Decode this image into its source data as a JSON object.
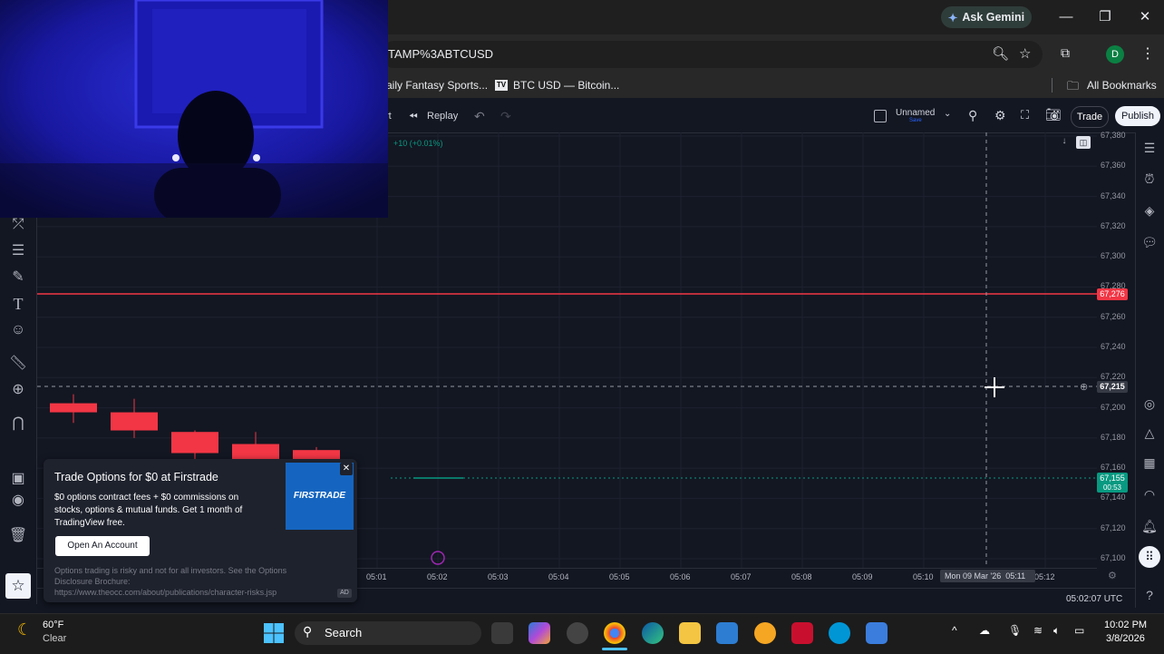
{
  "browser": {
    "url": "TAMP%3ABTCUSD",
    "ask_gemini": "Ask Gemini",
    "profile_initial": "D",
    "bookmarks": [
      "aily Fantasy Sports...",
      "BTC USD — Bitcoin..."
    ],
    "bookmark_icon_text": "TV",
    "all_bookmarks": "All Bookmarks"
  },
  "tv_toolbar": {
    "alert_partial": "rt",
    "replay": "Replay",
    "layout_name": "Unnamed",
    "layout_sub": "Save",
    "trade": "Trade",
    "publish": "Publish"
  },
  "symbol_change": "+10 (+0.01%)",
  "y_axis_ticks": [
    "67,380",
    "67,360",
    "67,340",
    "67,320",
    "67,300",
    "67,280",
    "67,260",
    "67,240",
    "67,220",
    "67,200",
    "67,180",
    "67,160",
    "67,140",
    "67,120",
    "67,100"
  ],
  "x_axis_ticks": [
    "05:01",
    "05:02",
    "05:03",
    "05:04",
    "05:05",
    "05:06",
    "05:07",
    "05:08",
    "05:09",
    "05:10",
    "05:12"
  ],
  "crosshair": {
    "price": "67,215",
    "date": "Mon 09 Mar '26",
    "time": "05:11"
  },
  "alert_line": {
    "price": "67,276",
    "color": "#f23645"
  },
  "last_price": {
    "price": "67,155",
    "countdown": "00:53",
    "color": "#089981"
  },
  "clock": "05:02:07 UTC",
  "chart_data": {
    "type": "candlestick",
    "ylim": [
      67100,
      67380
    ],
    "alert_level": 67276,
    "last_price": 67155,
    "crosshair_price": 67215,
    "candles": [
      {
        "x": "04:55",
        "open": 67221,
        "close": 67198,
        "high": 67221,
        "low": 67188
      },
      {
        "x": "04:56",
        "open": 67203,
        "close": 67197,
        "high": 67209,
        "low": 67190
      },
      {
        "x": "04:57",
        "open": 67197,
        "close": 67185,
        "high": 67206,
        "low": 67180
      },
      {
        "x": "04:58",
        "open": 67184,
        "close": 67170,
        "high": 67185,
        "low": 67162
      },
      {
        "x": "04:59",
        "open": 67176,
        "close": 67166,
        "high": 67184,
        "low": 67160
      },
      {
        "x": "05:00",
        "open": 67172,
        "close": 67150,
        "high": 67174,
        "low": 67140
      }
    ]
  },
  "ad": {
    "title": "Trade Options for $0 at Firstrade",
    "body": "$0 options contract fees + $0 commissions on stocks, options & mutual funds. Get 1 month of TradingView free.",
    "cta": "Open An Account",
    "logo": "FIRSTRADE",
    "disclaimer": "Options trading is risky and not for all investors. See the Options Disclosure Brochure:",
    "link": "https://www.theocc.com/about/publications/character-risks.jsp",
    "badge": "AD"
  },
  "taskbar": {
    "weather_temp": "60°F",
    "weather_cond": "Clear",
    "search": "Search",
    "time": "10:02 PM",
    "date": "3/8/2026"
  }
}
